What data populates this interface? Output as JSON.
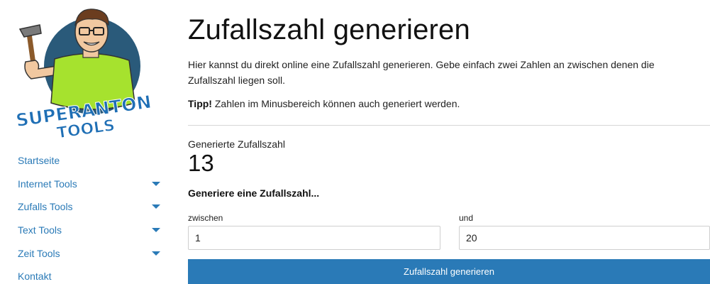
{
  "logo": {
    "line1": "SUPERANTON",
    "line2": "TOOLS"
  },
  "sidebar": {
    "items": [
      {
        "label": "Startseite",
        "has_dropdown": false
      },
      {
        "label": "Internet Tools",
        "has_dropdown": true
      },
      {
        "label": "Zufalls Tools",
        "has_dropdown": true
      },
      {
        "label": "Text Tools",
        "has_dropdown": true
      },
      {
        "label": "Zeit Tools",
        "has_dropdown": true
      },
      {
        "label": "Kontakt",
        "has_dropdown": false
      }
    ]
  },
  "main": {
    "title": "Zufallszahl generieren",
    "intro": "Hier kannst du direkt online eine Zufallszahl generieren. Gebe einfach zwei Zahlen an zwischen denen die Zufallszahl liegen soll.",
    "tip_strong": "Tipp!",
    "tip_text": " Zahlen im Minusbereich können auch generiert werden.",
    "result_label": "Generierte Zufallszahl",
    "result_value": "13",
    "generate_heading": "Generiere eine Zufallszahl...",
    "from_label": "zwischen",
    "from_value": "1",
    "to_label": "und",
    "to_value": "20",
    "button_label": "Zufallszahl generieren"
  },
  "colors": {
    "link": "#2a7ab7",
    "button": "#2a7ab7",
    "logo_text": "#1f6fb5",
    "shirt": "#a6e22e",
    "circle": "#2a5a7a"
  }
}
